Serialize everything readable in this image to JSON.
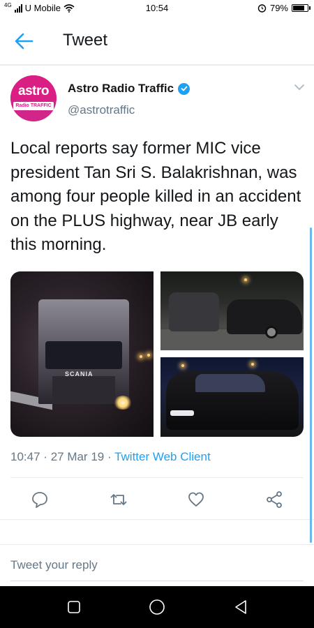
{
  "status_bar": {
    "carrier": "U Mobile",
    "network_tag": "4G",
    "time": "10:54",
    "battery": "79%",
    "icons": [
      "signal-icon",
      "wifi-icon",
      "alarm-icon",
      "battery-icon"
    ]
  },
  "header": {
    "title": "Tweet",
    "back_icon": "arrow-left-icon"
  },
  "tweet": {
    "author": {
      "display_name": "Astro Radio Traffic",
      "handle": "@astrotraffic",
      "verified": true,
      "avatar_text": "astro",
      "avatar_subtext": "Radio TRAFFIC"
    },
    "text": "Local reports say former MIC vice president Tan Sri S. Balakrishnan, was among four people killed in an accident on the PLUS highway, near JB early this morning.",
    "media": [
      {
        "scania_badge": "SCANIA"
      },
      {},
      {}
    ],
    "time": "10:47",
    "date": "27 Mar 19",
    "client": "Twitter Web Client",
    "separator": "·"
  },
  "actions": {
    "reply": "reply-icon",
    "retweet": "retweet-icon",
    "like": "heart-icon",
    "share": "share-icon"
  },
  "reply_box": {
    "placeholder": "Tweet your reply"
  },
  "colors": {
    "accent": "#1da1f2",
    "secondary_text": "#657786",
    "brand_avatar": "#d91f84"
  }
}
